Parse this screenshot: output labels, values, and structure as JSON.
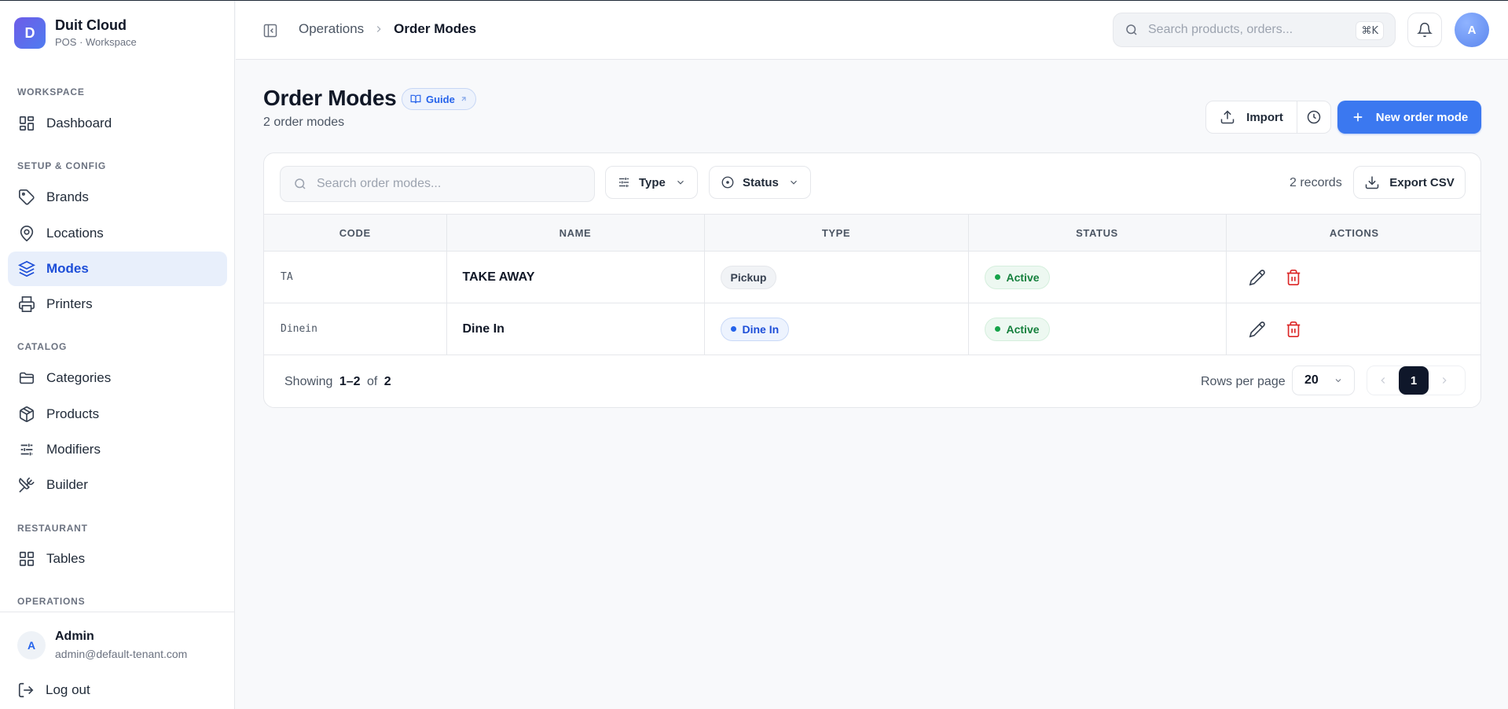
{
  "brand": {
    "initial": "D",
    "name": "Duit Cloud",
    "subtitle": "POS · Workspace"
  },
  "sidebar": {
    "sections": {
      "workspace": "WORKSPACE",
      "setup": "SETUP & CONFIG",
      "catalog": "CATALOG",
      "restaurant": "RESTAURANT",
      "operations": "OPERATIONS"
    },
    "items": {
      "dashboard": "Dashboard",
      "brands": "Brands",
      "locations": "Locations",
      "modes": "Modes",
      "printers": "Printers",
      "categories": "Categories",
      "products": "Products",
      "modifiers": "Modifiers",
      "builder": "Builder",
      "tables": "Tables"
    },
    "active_item": "Modes",
    "user": {
      "initial": "A",
      "name": "Admin",
      "email": "admin@default-tenant.com"
    },
    "logout": "Log out"
  },
  "topbar": {
    "breadcrumb": [
      "Operations",
      "Order Modes"
    ],
    "search_placeholder": "Search products, orders...",
    "shortcut": "⌘K",
    "avatar_initial": "A"
  },
  "header": {
    "title": "Order Modes",
    "guide_label": "Guide",
    "subtitle": "2 order modes",
    "import_label": "Import",
    "new_label": "New order mode"
  },
  "toolbar": {
    "search_placeholder": "Search order modes...",
    "type_filter": "Type",
    "status_filter": "Status",
    "records": "2 records",
    "export_label": "Export CSV"
  },
  "table": {
    "columns": [
      "CODE",
      "NAME",
      "TYPE",
      "STATUS",
      "ACTIONS"
    ],
    "rows": [
      {
        "code": "TA",
        "name": "TAKE AWAY",
        "type": "Pickup",
        "status": "Active"
      },
      {
        "code": "Dinein",
        "name": "Dine In",
        "type": "Dine In",
        "status": "Active"
      }
    ]
  },
  "footer": {
    "showing_prefix": "Showing",
    "range": "1–2",
    "of": "of",
    "total": "2",
    "rows_per_page_label": "Rows per page",
    "rows_per_page": "20",
    "current_page": "1"
  },
  "colors": {
    "accent": "#3b78f0",
    "active_nav_bg": "#e8effb",
    "status_active": "#15803d",
    "delete": "#dc2626"
  }
}
